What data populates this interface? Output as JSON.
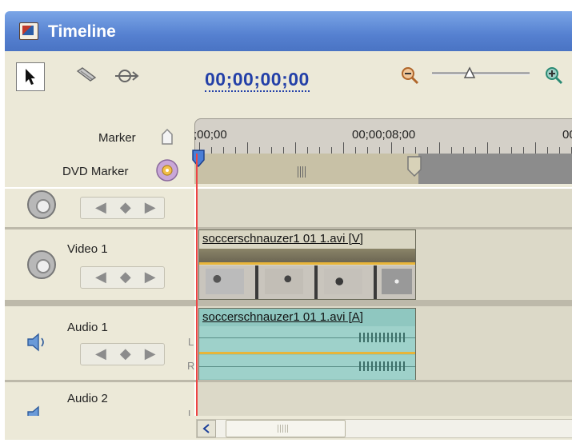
{
  "window": {
    "title": "Timeline"
  },
  "toolbar": {
    "timecode": "00;00;00;00",
    "tools": [
      "selection-tool",
      "razor-tool",
      "track-select-tool"
    ],
    "zoom_out_icon": "zoom-out-icon",
    "zoom_in_icon": "zoom-in-icon"
  },
  "header": {
    "marker_label": "Marker",
    "dvd_marker_label": "DVD Marker"
  },
  "ruler": {
    "time_start": ";00;00",
    "time_mid": "00;00;08;00",
    "time_end": "00"
  },
  "tracks": [
    {
      "id": "video-track-hidden",
      "label": ""
    },
    {
      "id": "video-1",
      "label": "Video 1",
      "clip": {
        "title": "soccerschnauzer1 01 1.avi [V]"
      }
    },
    {
      "id": "audio-1",
      "label": "Audio 1",
      "channel_l": "L",
      "channel_r": "R",
      "clip": {
        "title": "soccerschnauzer1 01 1.avi [A]"
      }
    },
    {
      "id": "audio-2",
      "label": "Audio 2",
      "channel_l": "L"
    }
  ],
  "colors": {
    "title_bar": "#5580d0",
    "panel_bg": "#ece9d8",
    "timecode": "#2340a8",
    "playhead": "#ee4444",
    "video_clip": "#d9d6c3",
    "audio_clip": "#8fc7c0",
    "clip_line": "#e8b53a"
  }
}
